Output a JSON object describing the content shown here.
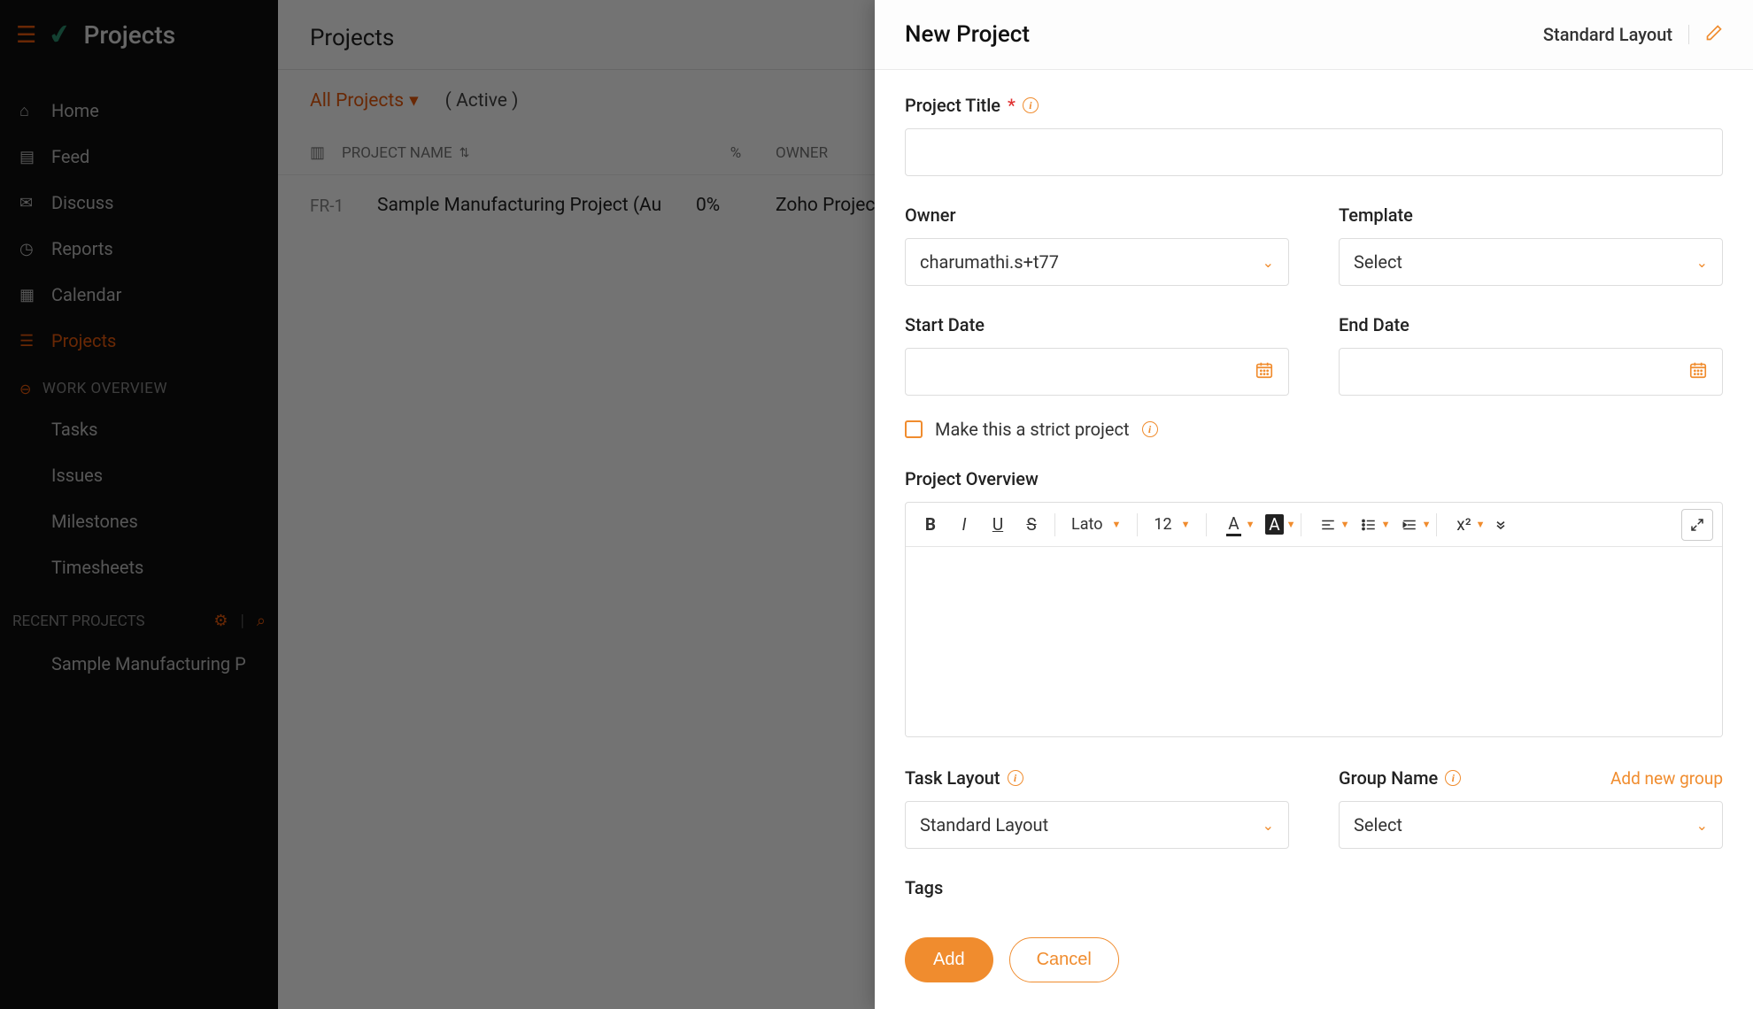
{
  "app": {
    "title": "Projects"
  },
  "sidebar": {
    "nav": [
      {
        "label": "Home",
        "icon": "⌂"
      },
      {
        "label": "Feed",
        "icon": "▤"
      },
      {
        "label": "Discuss",
        "icon": "✉"
      },
      {
        "label": "Reports",
        "icon": "◷"
      },
      {
        "label": "Calendar",
        "icon": "▦"
      },
      {
        "label": "Projects",
        "icon": "☰"
      }
    ],
    "work_section": "WORK OVERVIEW",
    "work_items": [
      {
        "label": "Tasks"
      },
      {
        "label": "Issues"
      },
      {
        "label": "Milestones"
      },
      {
        "label": "Timesheets"
      }
    ],
    "recent_header": "RECENT PROJECTS",
    "recent_item": "Sample Manufacturing P"
  },
  "main": {
    "header": "Projects",
    "filter_label": "All Projects",
    "active_label": "( Active )",
    "columns": {
      "name": "PROJECT NAME",
      "pct": "%",
      "owner": "OWNER"
    },
    "row": {
      "id": "FR-1",
      "name": "Sample Manufacturing Project (Au",
      "pct": "0%",
      "owner": "Zoho Project"
    }
  },
  "panel": {
    "title": "New Project",
    "layout_label": "Standard Layout",
    "fields": {
      "project_title": "Project Title",
      "owner": "Owner",
      "owner_value": "charumathi.s+t77",
      "template": "Template",
      "template_value": "Select",
      "start_date": "Start Date",
      "end_date": "End Date",
      "strict_label": "Make this a strict project",
      "overview": "Project Overview",
      "task_layout": "Task Layout",
      "task_layout_value": "Standard Layout",
      "group_name": "Group Name",
      "group_name_value": "Select",
      "add_group_link": "Add new group",
      "tags": "Tags"
    },
    "rte": {
      "font": "Lato",
      "size": "12",
      "super": "x²"
    },
    "buttons": {
      "add": "Add",
      "cancel": "Cancel"
    }
  }
}
